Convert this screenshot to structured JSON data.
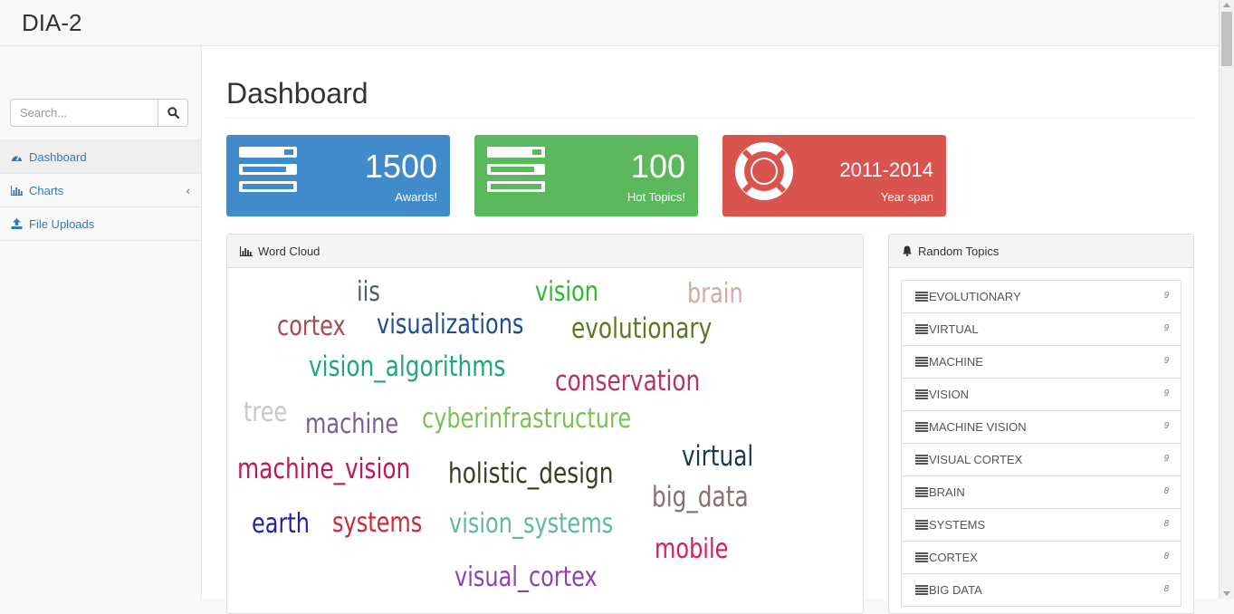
{
  "navbar": {
    "brand": "DIA-2"
  },
  "search": {
    "placeholder": "Search..."
  },
  "sidebar": {
    "items": [
      {
        "label": "Dashboard",
        "icon": "dashboard-icon",
        "active": true
      },
      {
        "label": "Charts",
        "icon": "bar-chart-icon",
        "active": false
      },
      {
        "label": "File Uploads",
        "icon": "upload-icon",
        "active": false
      }
    ]
  },
  "page": {
    "title": "Dashboard"
  },
  "stats": [
    {
      "value": "1500",
      "label": "Awards!",
      "icon": "tasks-icon",
      "color": "#428bca"
    },
    {
      "value": "100",
      "label": "Hot Topics!",
      "icon": "tasks-icon",
      "color": "#5cb85c"
    },
    {
      "value": "2011-2014",
      "label": "Year span",
      "icon": "life-ring-icon",
      "color": "#d9534f"
    }
  ],
  "word_cloud": {
    "title": "Word Cloud",
    "words": [
      {
        "text": "iis",
        "color": "#4d5d6b"
      },
      {
        "text": "vision",
        "color": "#2fb72f"
      },
      {
        "text": "brain",
        "color": "#d4a9a0"
      },
      {
        "text": "cortex",
        "color": "#a84a54"
      },
      {
        "text": "visualizations",
        "color": "#1f4e8c"
      },
      {
        "text": "evolutionary",
        "color": "#5b7a1e"
      },
      {
        "text": "vision_algorithms",
        "color": "#1fa77a"
      },
      {
        "text": "conservation",
        "color": "#b03a5d"
      },
      {
        "text": "tree",
        "color": "#c8c8c8"
      },
      {
        "text": "machine",
        "color": "#7b5c99"
      },
      {
        "text": "cyberinfrastructure",
        "color": "#7cc253"
      },
      {
        "text": "machine_vision",
        "color": "#c2185b"
      },
      {
        "text": "holistic_design",
        "color": "#3d3d1e"
      },
      {
        "text": "virtual",
        "color": "#173b57"
      },
      {
        "text": "big_data",
        "color": "#8a7070"
      },
      {
        "text": "earth",
        "color": "#2222aa"
      },
      {
        "text": "systems",
        "color": "#cc2a3a"
      },
      {
        "text": "vision_systems",
        "color": "#5fb8a2"
      },
      {
        "text": "mobile",
        "color": "#d81b60"
      },
      {
        "text": "visual_cortex",
        "color": "#8e44ad"
      }
    ]
  },
  "random_topics": {
    "title": "Random Topics",
    "items": [
      {
        "label": "EVOLUTIONARY",
        "count": "9"
      },
      {
        "label": "VIRTUAL",
        "count": "9"
      },
      {
        "label": "MACHINE",
        "count": "9"
      },
      {
        "label": "VISION",
        "count": "9"
      },
      {
        "label": "MACHINE VISION",
        "count": "9"
      },
      {
        "label": "VISUAL CORTEX",
        "count": "9"
      },
      {
        "label": "BRAIN",
        "count": "8"
      },
      {
        "label": "SYSTEMS",
        "count": "8"
      },
      {
        "label": "CORTEX",
        "count": "8"
      },
      {
        "label": "BIG DATA",
        "count": "8"
      }
    ]
  }
}
